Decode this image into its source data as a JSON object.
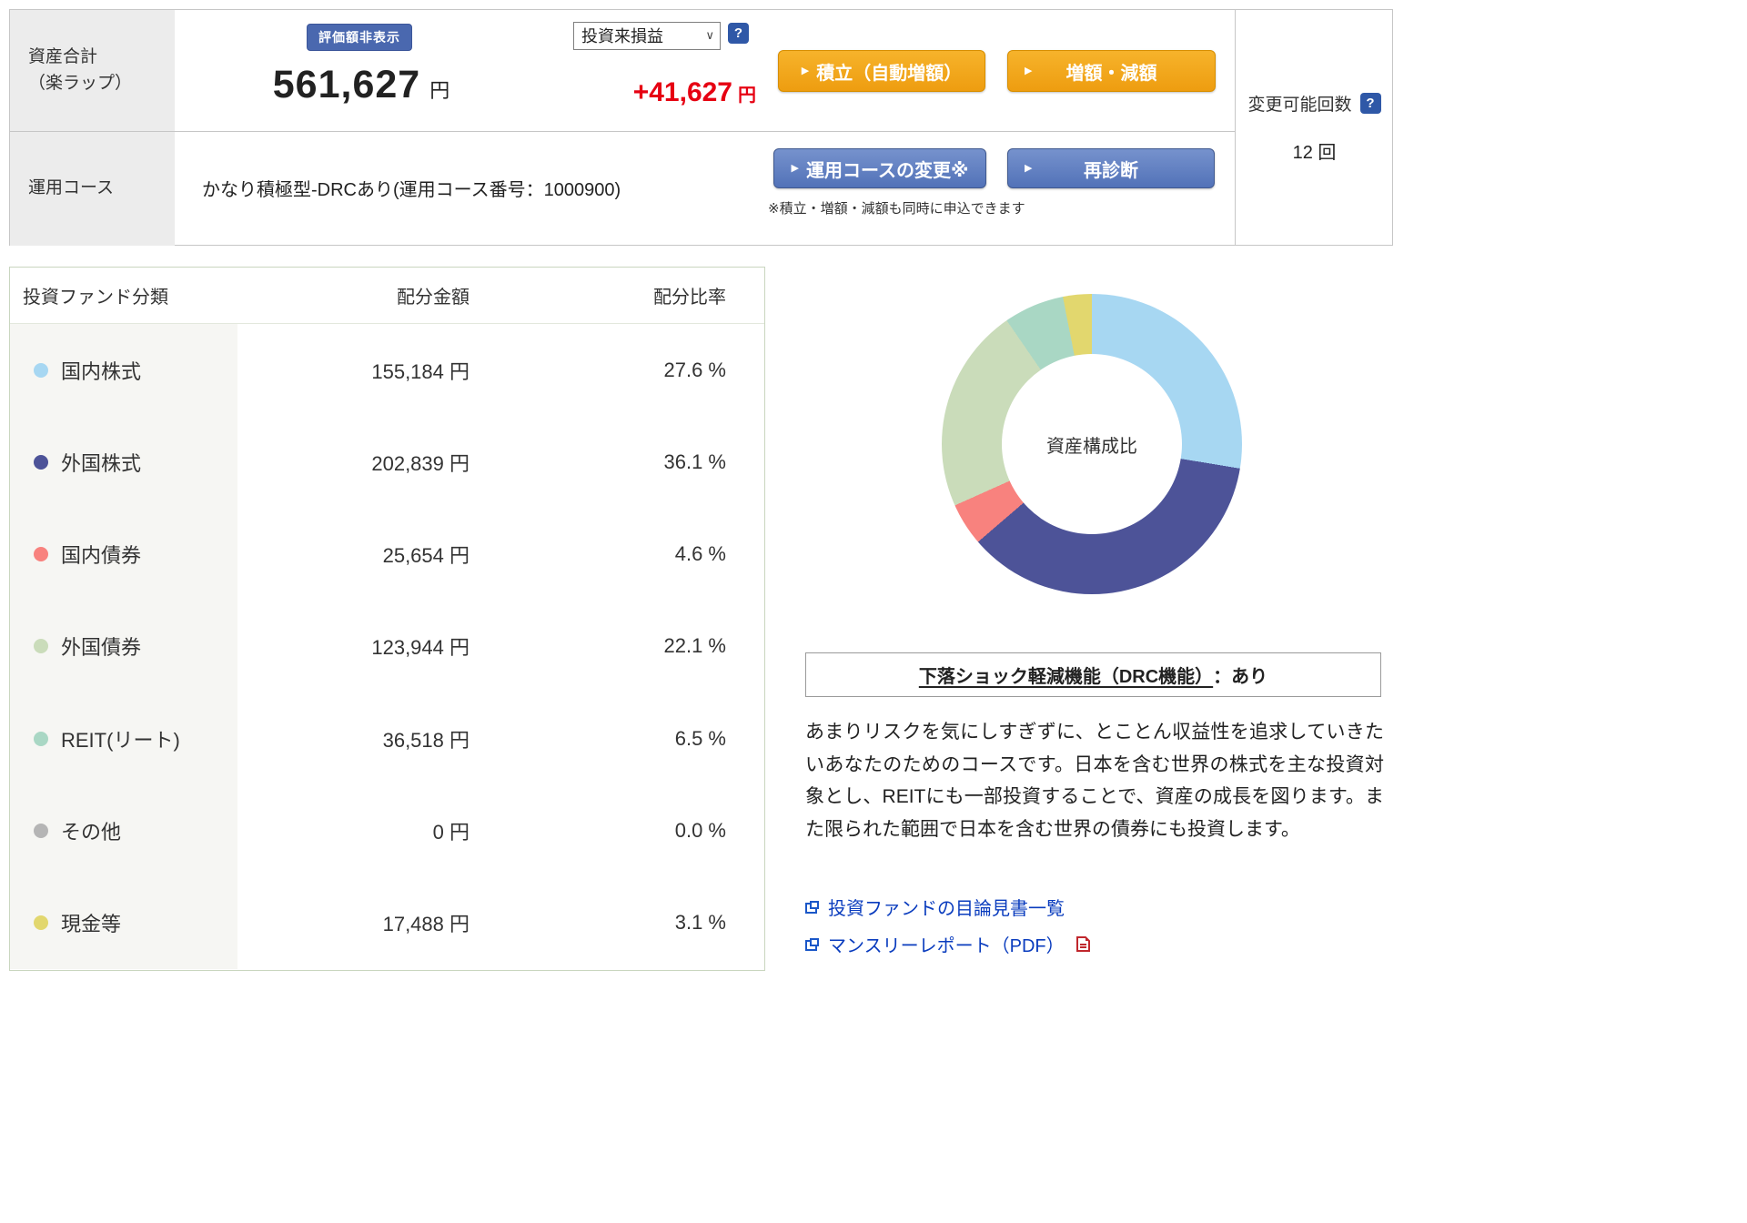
{
  "icons": {
    "help": "?",
    "button_arrow": "▶",
    "select_caret": "∨"
  },
  "colors": {
    "profit_positive": "#e60012",
    "accent_orange": "#f2a51d",
    "accent_blue": "#5e80c4",
    "link_blue": "#0a3cbe",
    "help_badge_blue": "#2f58a7",
    "hide_badge_blue": "#4a68af",
    "label_cell_gray": "#ececec"
  },
  "header": {
    "asset_total_label": "資産合計\n（楽ラップ）",
    "hide_badge": "評価額非表示",
    "total_amount": "561,627",
    "total_unit": "円",
    "profit_dropdown": {
      "selected": "投資来損益"
    },
    "profit_amount": "+41,627",
    "profit_unit": "円",
    "buttons": {
      "tsumitate": "積立（自動増額）",
      "zogaku": "増額・減額",
      "course_change": "運用コースの変更※",
      "rediagnosis": "再診断"
    },
    "course_label": "運用コース",
    "course_value": "かなり積極型-DRCあり(運用コース番号：1000900)",
    "course_note": "※積立・増額・減額も同時に申込できます",
    "change_limit": {
      "label": "変更可能回数",
      "value": "12 回"
    }
  },
  "allocation_table": {
    "headers": [
      "投資ファンド分類",
      "配分金額",
      "配分比率"
    ],
    "rows": [
      {
        "label": "国内株式",
        "color": "#a7d7f2",
        "amount": "155,184 円",
        "ratio": "27.6 %"
      },
      {
        "label": "外国株式",
        "color": "#4d5398",
        "amount": "202,839 円",
        "ratio": "36.1 %"
      },
      {
        "label": "国内債券",
        "color": "#f8827e",
        "amount": "25,654 円",
        "ratio": "4.6 %"
      },
      {
        "label": "外国債券",
        "color": "#cadcba",
        "amount": "123,944 円",
        "ratio": "22.1 %"
      },
      {
        "label": "REIT(リート)",
        "color": "#a9d7c4",
        "amount": "36,518 円",
        "ratio": "6.5 %"
      },
      {
        "label": "その他",
        "color": "#b5b5b5",
        "amount": "0 円",
        "ratio": "0.0 %"
      },
      {
        "label": "現金等",
        "color": "#e2d76e",
        "amount": "17,488 円",
        "ratio": "3.1 %"
      }
    ]
  },
  "chart_data": {
    "type": "pie",
    "donut": true,
    "title": "資産構成比",
    "legend_position": "none",
    "segments": [
      {
        "label": "国内株式",
        "value": 27.6,
        "color": "#a7d7f2"
      },
      {
        "label": "外国株式",
        "value": 36.1,
        "color": "#4d5398"
      },
      {
        "label": "国内債券",
        "value": 4.6,
        "color": "#f8827e"
      },
      {
        "label": "外国債券",
        "value": 22.1,
        "color": "#cadcba"
      },
      {
        "label": "REIT(リート)",
        "value": 6.5,
        "color": "#a9d7c4"
      },
      {
        "label": "その他",
        "value": 0.0,
        "color": "#b5b5b5"
      },
      {
        "label": "現金等",
        "value": 3.1,
        "color": "#e2d76e"
      }
    ]
  },
  "drc_box": {
    "title_underlined": "下落ショック軽減機能（DRC機能）",
    "title_suffix": "：あり"
  },
  "course_description": "あまりリスクを気にしすぎずに、とことん収益性を追求していきたいあなたのためのコースです。日本を含む世界の株式を主な投資対象とし、REITにも一部投資することで、資産の成長を図ります。また限られた範囲で日本を含む世界の債券にも投資します。",
  "links": {
    "prospectus": "投資ファンドの目論見書一覧",
    "monthly_report": "マンスリーレポート（PDF）"
  }
}
